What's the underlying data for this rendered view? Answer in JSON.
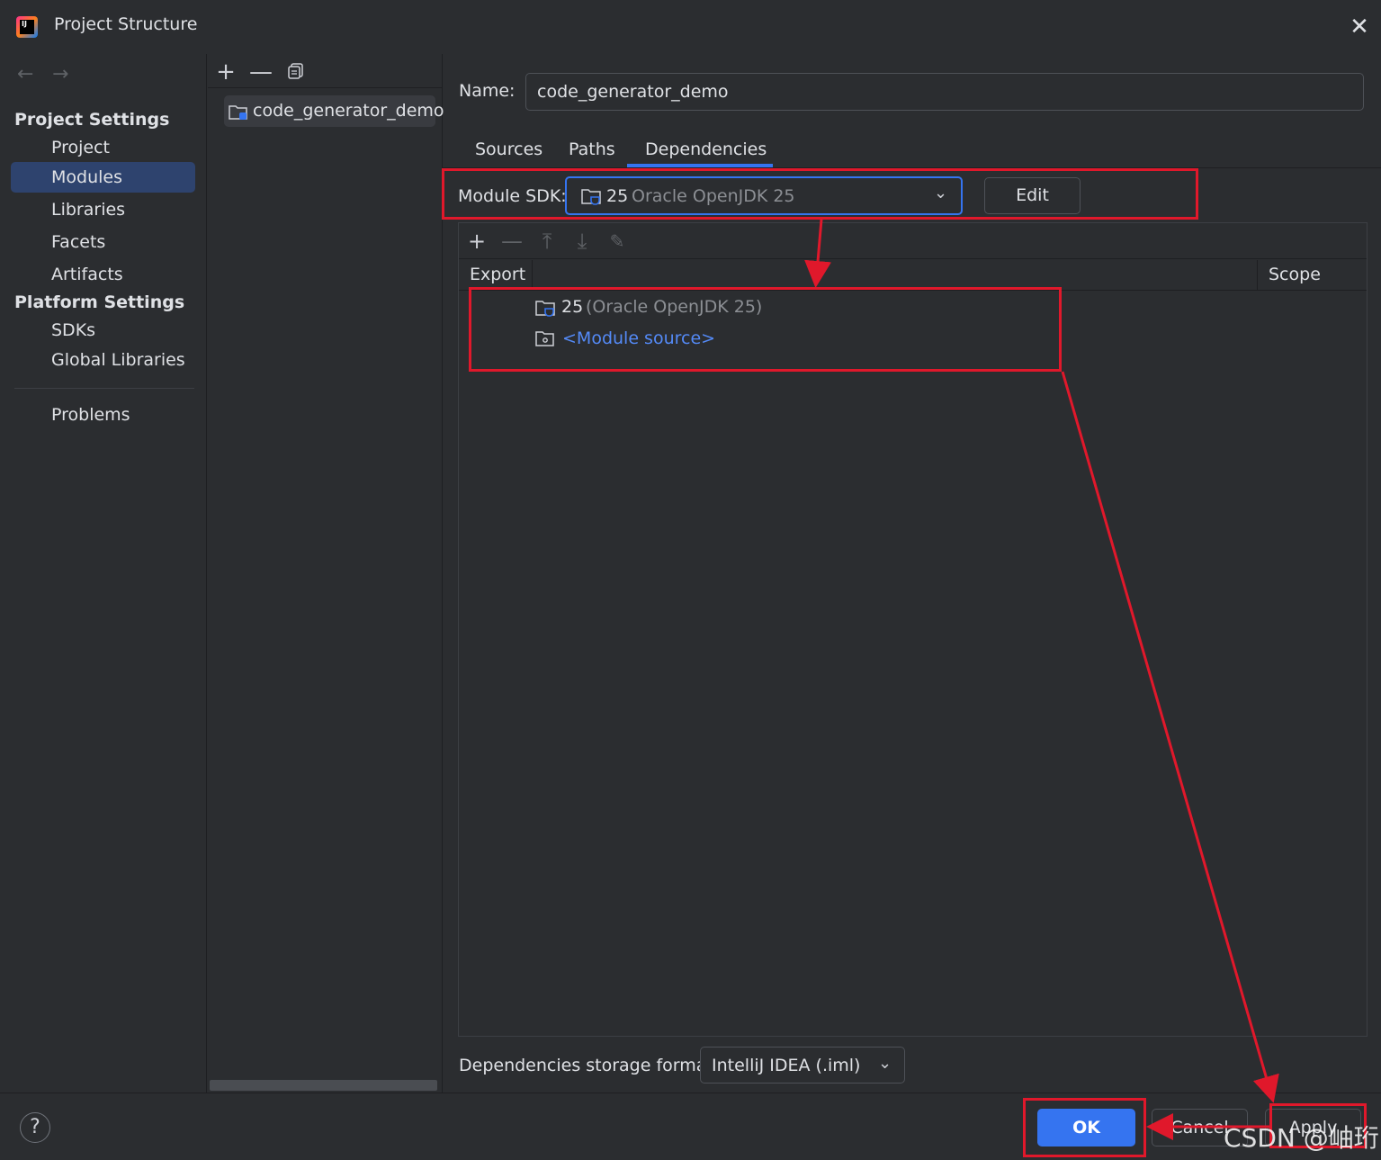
{
  "window": {
    "title": "Project Structure"
  },
  "icons": {
    "app": "intellij-logo-icon",
    "close": "close-icon",
    "back": "back-arrow-icon",
    "forward": "forward-arrow-icon",
    "add": "plus-icon",
    "remove": "minus-icon",
    "copy": "copy-icon",
    "folder": "module-folder-icon",
    "chevron": "chevron-down-icon",
    "help": "help-icon"
  },
  "sidebar": {
    "project_settings_heading": "Project Settings",
    "project_items": [
      "Project",
      "Modules",
      "Libraries",
      "Facets",
      "Artifacts"
    ],
    "selected_item": "Modules",
    "platform_settings_heading": "Platform Settings",
    "platform_items": [
      "SDKs",
      "Global Libraries"
    ],
    "problems": "Problems"
  },
  "modules": {
    "items": [
      "code_generator_demo"
    ]
  },
  "main": {
    "name_label": "Name:",
    "name_value": "code_generator_demo",
    "tabs": [
      "Sources",
      "Paths",
      "Dependencies"
    ],
    "active_tab": "Dependencies",
    "sdk_label": "Module SDK:",
    "sdk_version": "25",
    "sdk_name": "Oracle OpenJDK 25",
    "edit_label": "Edit",
    "deps": {
      "export_header": "Export",
      "scope_header": "Scope",
      "row1_version": "25",
      "row1_name": "(Oracle OpenJDK 25)",
      "row2_label": "<Module source>"
    },
    "storage_label": "Dependencies storage format:",
    "storage_value": "IntelliJ IDEA (.iml)"
  },
  "footer": {
    "help": "?",
    "ok": "OK",
    "cancel": "Cancel",
    "apply": "Apply"
  },
  "watermark": "CSDN @岫珩",
  "colors": {
    "accent": "#3574f0",
    "annotation": "#e0182b",
    "link": "#548af7",
    "background": "#2b2d30"
  }
}
